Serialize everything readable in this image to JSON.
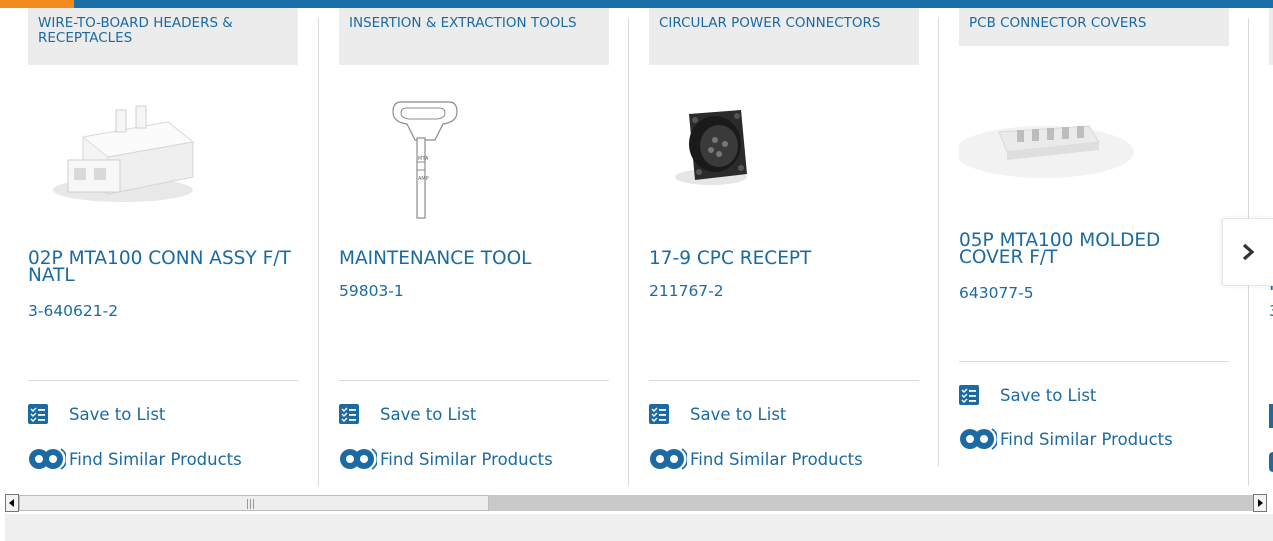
{
  "colors": {
    "link": "#1b6aa3",
    "category_bg": "#ececec",
    "top_bar": "#1a6fa8",
    "top_accent": "#f28c1e"
  },
  "cards": [
    {
      "category": "WIRE-TO-BOARD HEADERS & RECEPTACLES",
      "title": "02P MTA100 CONN ASSY F/T NATL",
      "part_number": "3-640621-2",
      "image": "white-2-position-connector-housing",
      "save_label": "Save to List",
      "similar_label": "Find Similar Products"
    },
    {
      "category": "INSERTION & EXTRACTION TOOLS",
      "title": "MAINTENANCE TOOL",
      "part_number": "59803-1",
      "image": "t-handle-extraction-tool",
      "save_label": "Save to List",
      "similar_label": "Find Similar Products"
    },
    {
      "category": "CIRCULAR POWER CONNECTORS",
      "title": "17-9 CPC RECEPT",
      "part_number": "211767-2",
      "image": "black-circular-receptacle",
      "save_label": "Save to List",
      "similar_label": "Find Similar Products"
    },
    {
      "category": "PCB CONNECTOR COVERS",
      "title": "05P MTA100 MOLDED COVER F/T",
      "part_number": "643077-5",
      "image": "white-5-position-cover",
      "save_label": "Save to List",
      "similar_label": "Find Similar Products"
    }
  ],
  "partial_card": {
    "title_fragment": "I",
    "part_fragment": "3"
  },
  "icons": {
    "save": "checklist-icon",
    "similar": "gears-icon",
    "next": "chevron-right-icon",
    "scroll_left": "scroll-left-arrow-icon",
    "scroll_right": "scroll-right-arrow-icon"
  }
}
